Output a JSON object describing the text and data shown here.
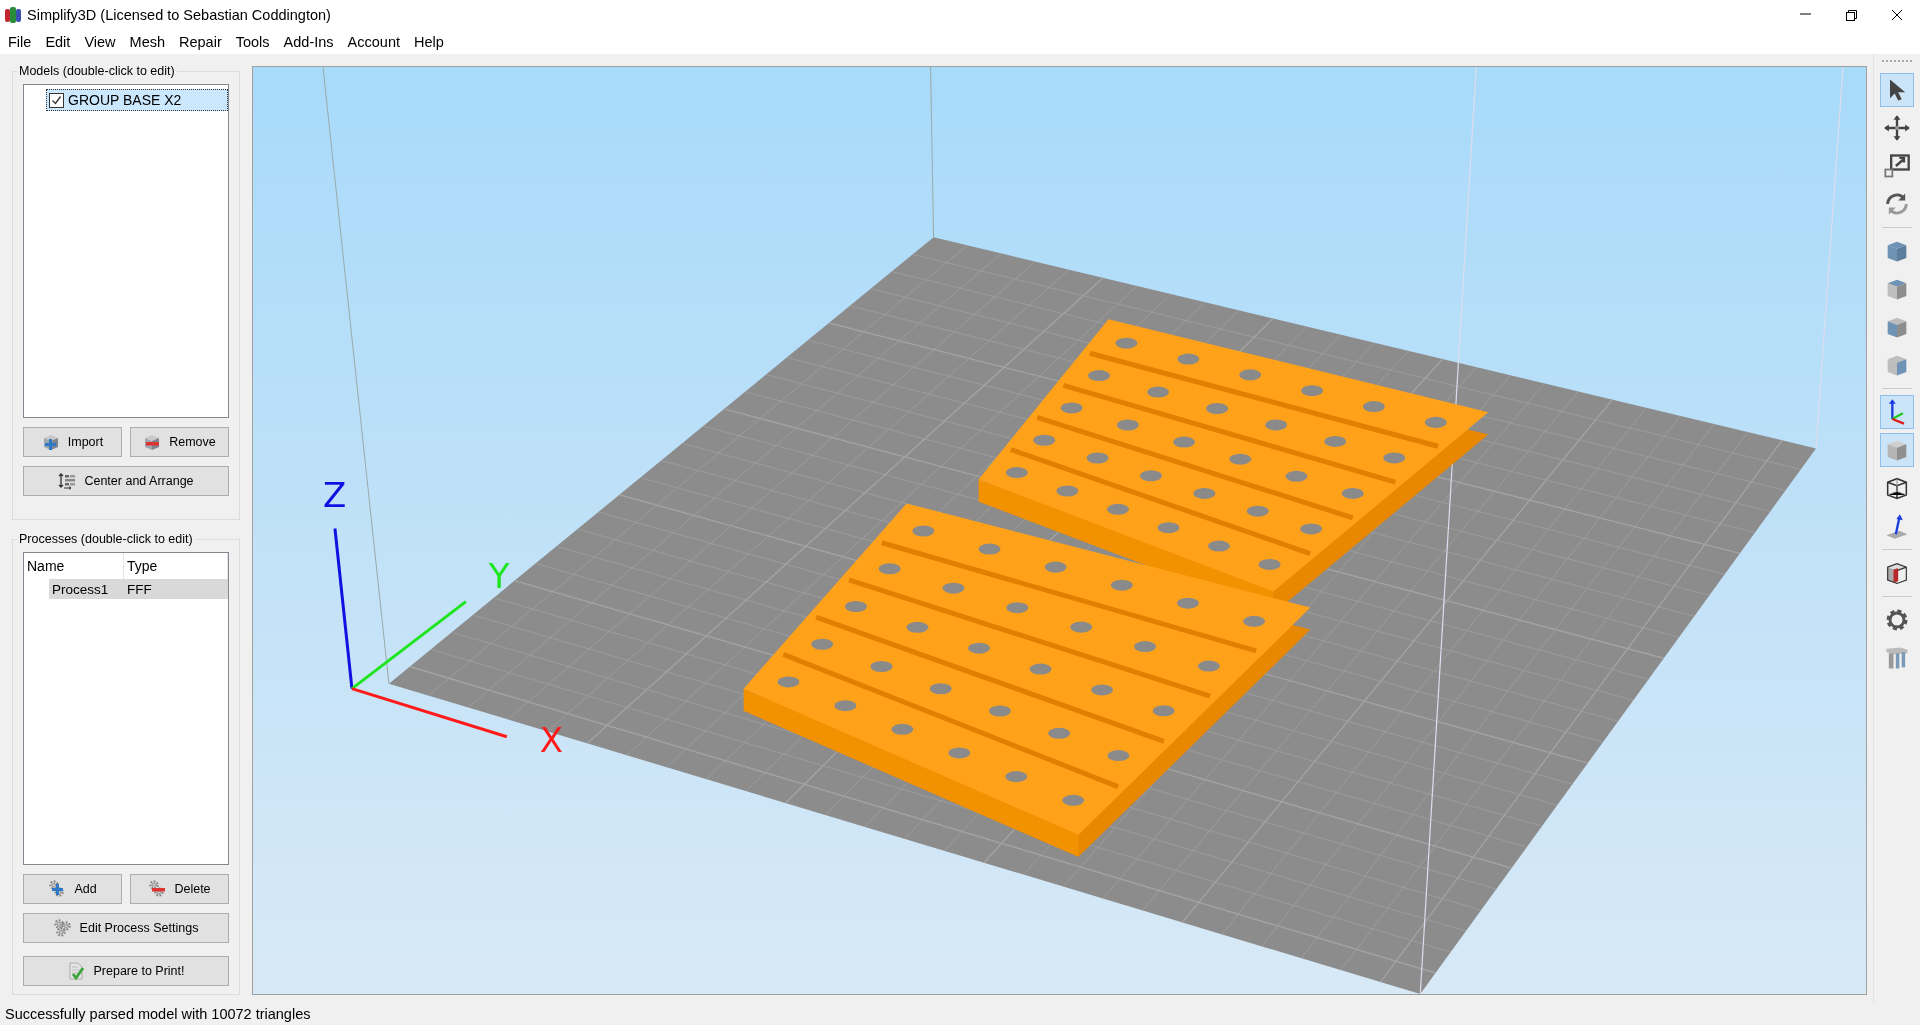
{
  "window": {
    "title": "Simplify3D (Licensed to Sebastian Coddington)"
  },
  "menu": [
    "File",
    "Edit",
    "View",
    "Mesh",
    "Repair",
    "Tools",
    "Add-Ins",
    "Account",
    "Help"
  ],
  "models": {
    "title": "Models (double-click to edit)",
    "items": [
      {
        "name": "GROUP BASE X2",
        "checked": true,
        "selected": true
      }
    ],
    "buttons": [
      {
        "label": "Import",
        "kind": "import"
      },
      {
        "label": "Remove",
        "kind": "remove"
      },
      {
        "label": "Center and Arrange",
        "kind": "arrange"
      }
    ]
  },
  "processes": {
    "title": "Processes (double-click to edit)",
    "columns": [
      "Name",
      "Type"
    ],
    "rows": [
      {
        "cells": [
          "Process1",
          "FFF"
        ],
        "selected": true
      }
    ],
    "buttons": [
      {
        "label": "Add",
        "kind": "add"
      },
      {
        "label": "Delete",
        "kind": "delete"
      },
      {
        "label": "Edit Process Settings",
        "kind": "edit"
      }
    ],
    "prepare_button": {
      "label": "Prepare to Print!",
      "kind": "prepare"
    }
  },
  "viewport": {
    "axis_labels": [
      {
        "kind": "z",
        "label": "Z"
      },
      {
        "kind": "y",
        "label": "Y"
      },
      {
        "kind": "x",
        "label": "X"
      }
    ]
  },
  "toolbar": {
    "groups": [
      [
        {
          "kind": "pointer",
          "selected": true
        },
        {
          "kind": "move",
          "selected": false
        },
        {
          "kind": "scale",
          "selected": false
        },
        {
          "kind": "rotate",
          "selected": false
        }
      ],
      [
        {
          "kind": "view-iso",
          "selected": false
        },
        {
          "kind": "view-top",
          "selected": false
        },
        {
          "kind": "view-front",
          "selected": false
        },
        {
          "kind": "view-side",
          "selected": false
        }
      ],
      [
        {
          "kind": "axes",
          "selected": true
        },
        {
          "kind": "solid",
          "selected": true
        },
        {
          "kind": "wireframe",
          "selected": false
        },
        {
          "kind": "normals",
          "selected": false
        }
      ],
      [
        {
          "kind": "section",
          "selected": false
        }
      ],
      [
        {
          "kind": "settings",
          "selected": false
        },
        {
          "kind": "supports",
          "selected": false
        }
      ]
    ]
  },
  "status_bar": "Successfully parsed model with 10072 triangles"
}
